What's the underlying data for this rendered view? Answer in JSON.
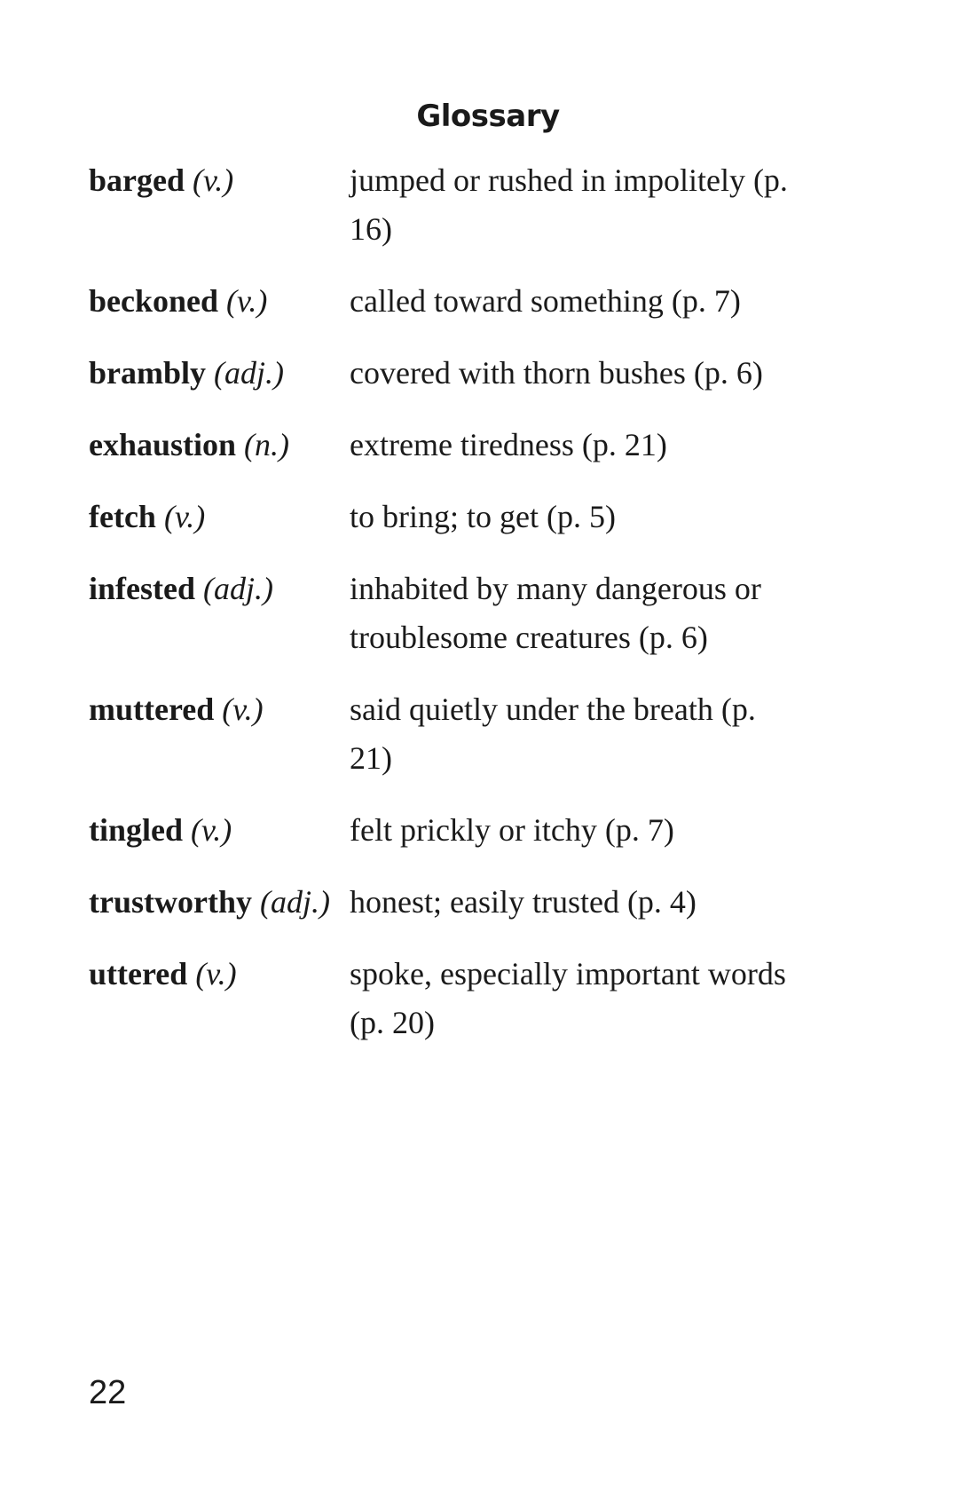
{
  "page": {
    "title": "Glossary",
    "page_number": "22"
  },
  "entries": [
    {
      "term": "barged",
      "pos": "(v.)",
      "definition": "jumped or rushed in impolitely (p. 16)"
    },
    {
      "term": "beckoned",
      "pos": "(v.)",
      "definition": "called toward something (p. 7)"
    },
    {
      "term": "brambly",
      "pos": "(adj.)",
      "definition": "covered with thorn bushes (p. 6)"
    },
    {
      "term": "exhaustion",
      "pos": "(n.)",
      "definition": "extreme tiredness (p. 21)"
    },
    {
      "term": "fetch",
      "pos": "(v.)",
      "definition": "to bring; to get (p. 5)"
    },
    {
      "term": "infested",
      "pos": "(adj.)",
      "definition": "inhabited by many dangerous or troublesome creatures (p. 6)"
    },
    {
      "term": "muttered",
      "pos": "(v.)",
      "definition": "said quietly under the breath (p. 21)"
    },
    {
      "term": "tingled",
      "pos": "(v.)",
      "definition": "felt prickly or itchy (p. 7)"
    },
    {
      "term": "trustworthy",
      "pos": "(adj.)",
      "definition": "honest; easily trusted (p. 4)"
    },
    {
      "term": "uttered",
      "pos": "(v.)",
      "definition": "spoke, especially important words (p. 20)"
    }
  ]
}
